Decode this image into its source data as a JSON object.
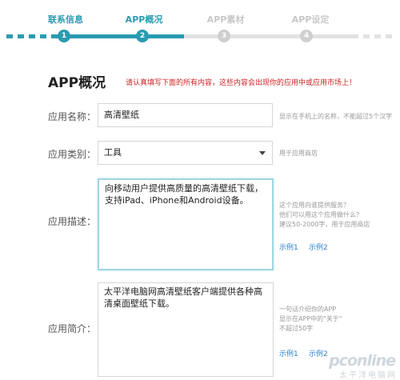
{
  "steps": [
    {
      "label": "联系信息",
      "number": "1",
      "state": "done"
    },
    {
      "label": "APP概况",
      "number": "2",
      "state": "current"
    },
    {
      "label": "APP素材",
      "number": "3",
      "state": "todo"
    },
    {
      "label": "APP设定",
      "number": "4",
      "state": "todo"
    }
  ],
  "heading": {
    "title": "APP概况",
    "notice": "请认真填写下面的所有内容，这些内容会出现你的应用中或应用市场上！"
  },
  "form": {
    "name": {
      "label": "应用名称：",
      "value": "高清壁纸",
      "hint": "显示在手机上的名称，不能超过5个汉字"
    },
    "category": {
      "label": "应用类别：",
      "value": "工具",
      "hint": "用于应用商店"
    },
    "description": {
      "label": "应用描述：",
      "value": "向移动用户提供高质量的高清壁纸下载，支持iPad、iPhone和Android设备。",
      "hint_lines": [
        "这个应用向谁提供服务？",
        "他们可以用这个应用做什么？",
        "建议50-2000字，用于应用商店"
      ],
      "example1": "示例1",
      "example2": "示例2"
    },
    "summary": {
      "label": "应用简介：",
      "value": "太平洋电脑网高清壁纸客户端提供各种高清桌面壁纸下载。",
      "hint_lines": [
        "一句话介绍你的APP",
        "显示在APP中的\"关于\"",
        "不超过50字"
      ],
      "example1": "示例1",
      "example2": "示例2"
    }
  },
  "watermark": {
    "main": "pconline",
    "sub": "太平洋电脑网"
  },
  "colors": {
    "accent": "#2b9bb0",
    "inactive": "#cfcfcf",
    "notice": "#cc2222",
    "link": "#2b7fc6"
  }
}
